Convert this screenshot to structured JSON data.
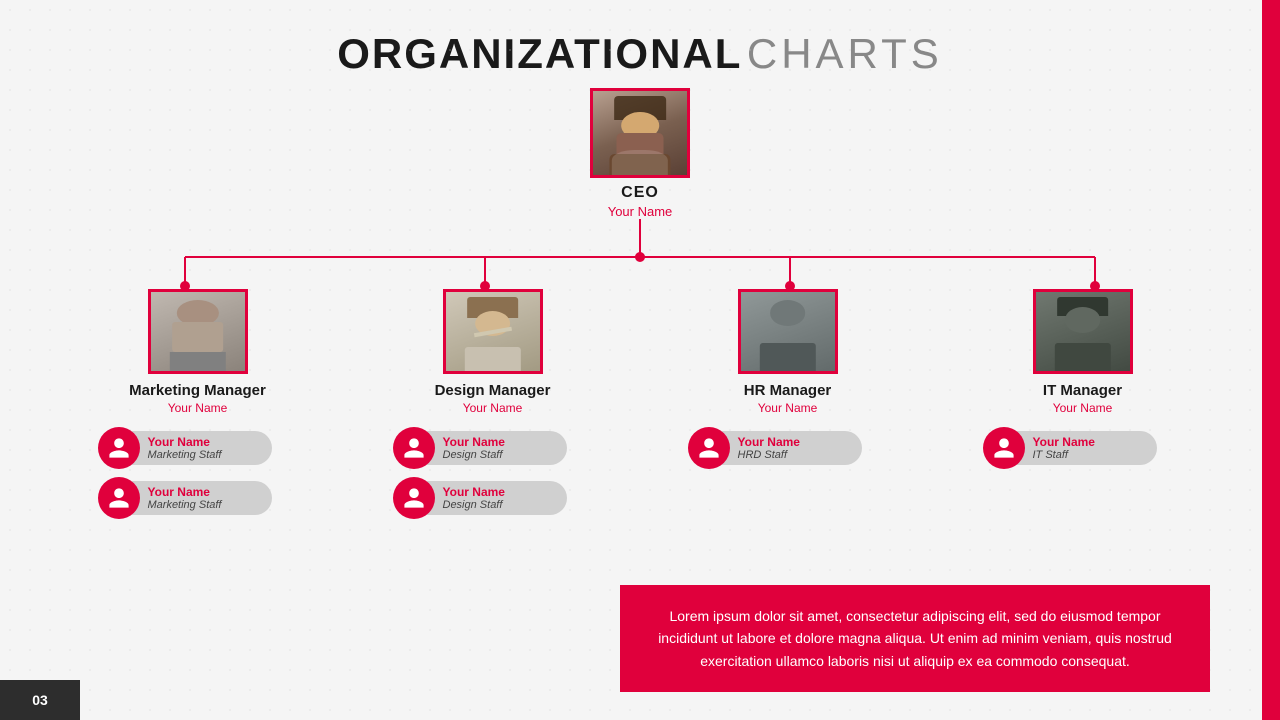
{
  "title": {
    "bold": "ORGANIZATIONAL",
    "light": "CHARTS"
  },
  "page_number": "03",
  "ceo": {
    "role": "CEO",
    "name": "Your Name"
  },
  "managers": [
    {
      "id": "marketing",
      "role": "Marketing Manager",
      "name": "Your Name",
      "photo_class": "photo-mm",
      "staff": [
        {
          "name": "Your Name",
          "role": "Marketing Staff"
        },
        {
          "name": "Your Name",
          "role": "Marketing Staff"
        }
      ]
    },
    {
      "id": "design",
      "role": "Design Manager",
      "name": "Your Name",
      "photo_class": "photo-dm",
      "staff": [
        {
          "name": "Your Name",
          "role": "Design Staff"
        },
        {
          "name": "Your Name",
          "role": "Design Staff"
        }
      ]
    },
    {
      "id": "hr",
      "role": "HR Manager",
      "name": "Your Name",
      "photo_class": "photo-hr",
      "staff": [
        {
          "name": "Your Name",
          "role": "HRD Staff"
        }
      ]
    },
    {
      "id": "it",
      "role": "IT Manager",
      "name": "Your Name",
      "photo_class": "photo-it",
      "staff": [
        {
          "name": "Your Name",
          "role": "IT Staff"
        }
      ]
    }
  ],
  "lorem": "Lorem ipsum dolor sit amet, consectetur adipiscing elit, sed do eiusmod tempor incididunt ut labore et dolore magna aliqua. Ut enim ad minim veniam, quis nostrud exercitation ullamco laboris nisi ut aliquip ex ea commodo consequat."
}
